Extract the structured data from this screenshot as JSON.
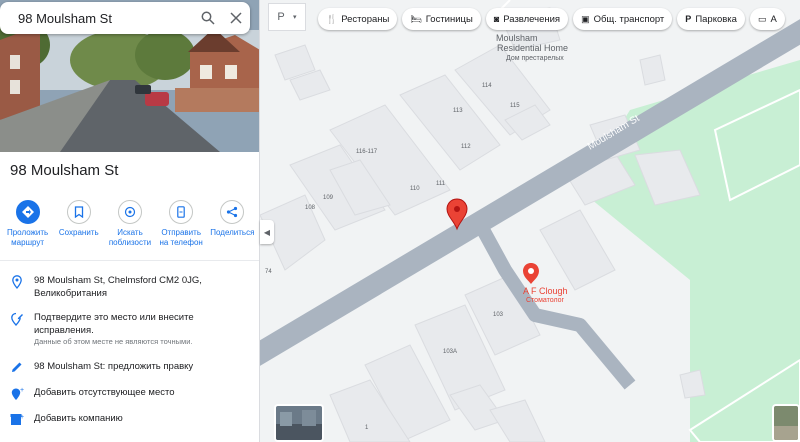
{
  "search": {
    "value": "98 Moulsham St"
  },
  "place": {
    "title": "98 Moulsham St"
  },
  "actions": [
    {
      "label": "Проложить маршрут",
      "icon": "directions-icon"
    },
    {
      "label": "Сохранить",
      "icon": "bookmark-icon"
    },
    {
      "label": "Искать поблизости",
      "icon": "nearby-icon"
    },
    {
      "label": "Отправить на телефон",
      "icon": "phone-icon"
    },
    {
      "label": "Поделиться",
      "icon": "share-icon"
    }
  ],
  "info": {
    "address_line1": "98 Moulsham St, Chelmsford CM2 0JG,",
    "address_line2": "Великобритания",
    "confirm_line1": "Подтвердите это место или внесите",
    "confirm_line2": "исправления.",
    "confirm_note": "Данные об этом месте не являются точными.",
    "suggest_edit": "98 Moulsham St: предложить правку",
    "add_missing": "Добавить отсутствующее место",
    "add_business": "Добавить компанию"
  },
  "map": {
    "layers_label": "Р",
    "chips": [
      {
        "label": "Рестораны",
        "icon": "restaurant-icon"
      },
      {
        "label": "Гостиницы",
        "icon": "hotel-icon"
      },
      {
        "label": "Развлечения",
        "icon": "camera-icon"
      },
      {
        "label": "Общ. транспорт",
        "icon": "transit-icon"
      },
      {
        "label": "Парковка",
        "icon": "parking-icon"
      },
      {
        "label": "А",
        "icon": "atm-icon"
      }
    ],
    "street_name": "Moulsham St",
    "poi_residential_name_1": "Moulsham",
    "poi_residential_name_2": "Residential Home",
    "poi_residential_sub": "Дом престарелых",
    "poi_dentist_name": "A F Clough",
    "poi_dentist_sub": "Стоматолог",
    "numbers": [
      "114",
      "115",
      "113",
      "112",
      "116-117",
      "111",
      "110",
      "109",
      "108",
      "74",
      "103",
      "103A",
      "1"
    ]
  },
  "colors": {
    "road": "#aab4c0",
    "building": "#e8eaed",
    "park": "#c8efd4",
    "pin": "#ea4335",
    "accent": "#1a73e8"
  }
}
